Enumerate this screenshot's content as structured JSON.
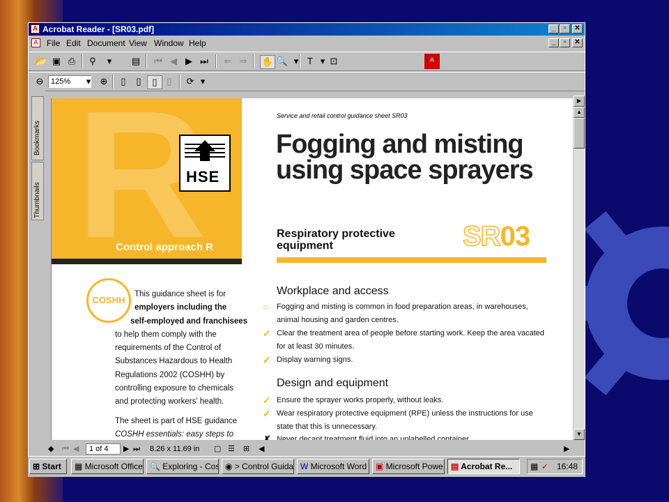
{
  "window": {
    "title": "Acrobat Reader - [SR03.pdf]",
    "buttons": [
      "_",
      "▫",
      "✕"
    ]
  },
  "menu": [
    "File",
    "Edit",
    "Document",
    "View",
    "Window",
    "Help"
  ],
  "toolbar2": {
    "zoom": "125%"
  },
  "sidetabs": {
    "bookmarks": "Bookmarks",
    "thumbnails": "Thumbnails"
  },
  "page": {
    "header_small": "Service and retail control guidance sheet SR03",
    "title_line1": "Fogging and misting",
    "title_line2": "using space sprayers",
    "control_approach": "Control approach R",
    "hse": "HSE",
    "rpe_line1": "Respiratory protective",
    "rpe_line2": "equipment",
    "code_prefix": "SR",
    "code_num": "03",
    "coshh": "COSHH",
    "left_paragraph": [
      "This guidance sheet is for",
      "employers including the",
      "self-employed and franchisees",
      "to help them comply with the",
      "requirements of the Control of",
      "Substances Hazardous to Health",
      "Regulations 2002 (COSHH) by",
      "controlling exposure to chemicals",
      "and protecting workers' health."
    ],
    "left_paragraph2": [
      "The sheet is part of HSE guidance",
      "COSHH essentials: easy steps to"
    ],
    "section1_title": "Workplace and access",
    "section1_items": [
      {
        "mark": "○",
        "text": "Fogging and misting is common in food preparation areas, in warehouses, animal housing and garden centres."
      },
      {
        "mark": "✓",
        "text": "Clear the treatment area of people before starting work. Keep the area vacated for at least 30 minutes."
      },
      {
        "mark": "✓",
        "text": "Display warning signs."
      }
    ],
    "section2_title": "Design and equipment",
    "section2_items": [
      {
        "mark": "✓",
        "text": "Ensure the sprayer works properly, without leaks."
      },
      {
        "mark": "✓",
        "text": "Wear respiratory protective equipment (RPE) unless the instructions for use state that this is unnecessary."
      },
      {
        "mark": "✗",
        "text": "Never decant treatment fluid into an unlabelled container."
      }
    ]
  },
  "status": {
    "page": "1 of 4",
    "size": "8.26 x 11.69 in"
  },
  "taskbar": {
    "start": "Start",
    "tasks": [
      "Microsoft Office",
      "Exploring - Cos...",
      "> Control Guida...",
      "Microsoft Word",
      "Microsoft Powe...",
      "Acrobat Re..."
    ],
    "clock": "16:48"
  }
}
